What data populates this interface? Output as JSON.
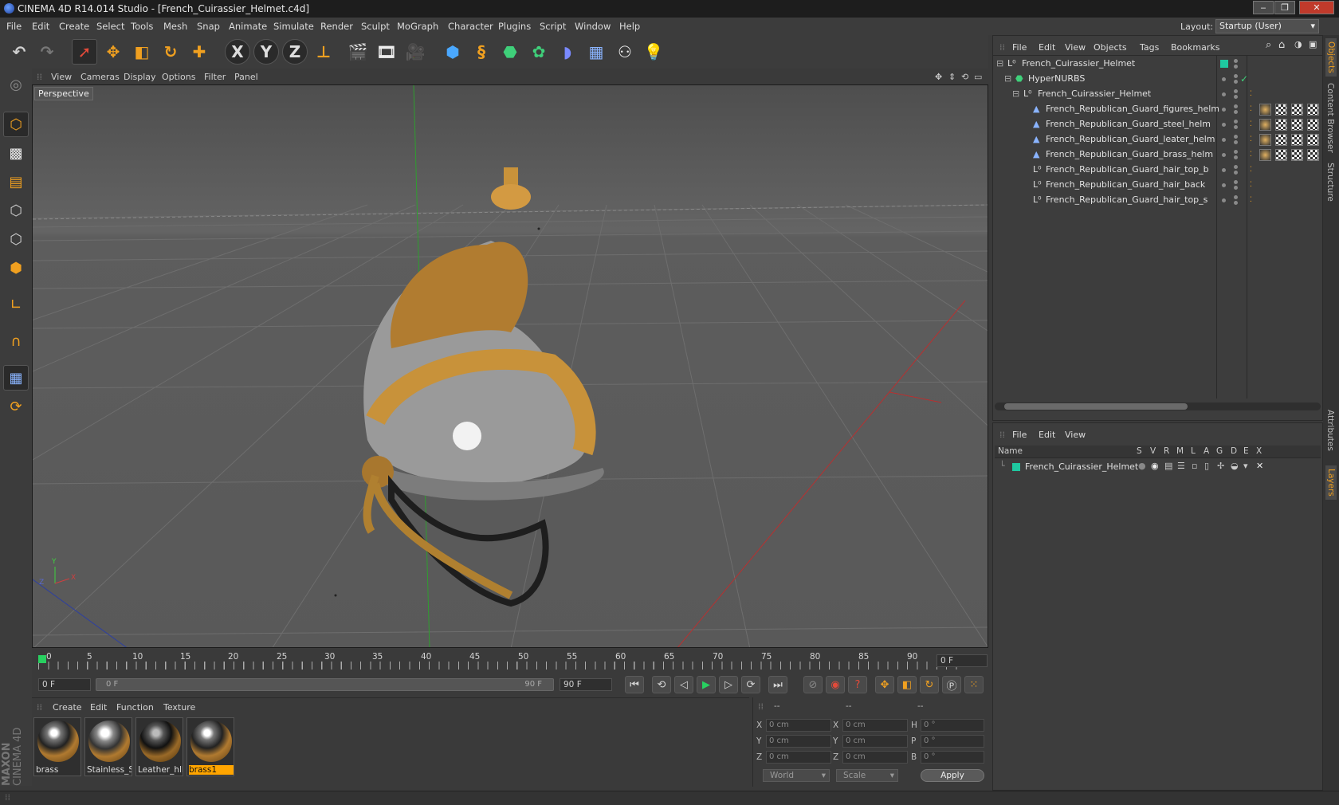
{
  "window": {
    "title": "CINEMA 4D R14.014 Studio - [French_Cuirassier_Helmet.c4d]",
    "controls": [
      "‒",
      "❐",
      "✕"
    ]
  },
  "menu": [
    "File",
    "Edit",
    "Create",
    "Select",
    "Tools",
    "Mesh",
    "Snap",
    "Animate",
    "Simulate",
    "Render",
    "Sculpt",
    "MoGraph",
    "Character",
    "Plugins",
    "Script",
    "Window",
    "Help"
  ],
  "layout": {
    "label": "Layout:",
    "value": "Startup (User)"
  },
  "axis_buttons": [
    "X",
    "Y",
    "Z"
  ],
  "viewport": {
    "menu": [
      "View",
      "Cameras",
      "Display",
      "Options",
      "Filter",
      "Panel"
    ],
    "label": "Perspective"
  },
  "timeline": {
    "ticks": [
      "0",
      "5",
      "10",
      "15",
      "20",
      "25",
      "30",
      "35",
      "40",
      "45",
      "50",
      "55",
      "60",
      "65",
      "70",
      "75",
      "80",
      "85",
      "90"
    ],
    "current_frame": "0 F",
    "start_field": "0 F",
    "range_start": "0 F",
    "range_end": "90 F",
    "end_field": "90 F"
  },
  "materials": {
    "menu": [
      "Create",
      "Edit",
      "Function",
      "Texture"
    ],
    "items": [
      {
        "name": "brass",
        "selected": false
      },
      {
        "name": "Stainless_S",
        "selected": false
      },
      {
        "name": "Leather_hll",
        "selected": false
      },
      {
        "name": "brass1",
        "selected": true
      }
    ]
  },
  "coordinates": {
    "headers": [
      "--",
      "--",
      "--"
    ],
    "rows": [
      {
        "a": "X",
        "av": "0 cm",
        "b": "X",
        "bv": "0 cm",
        "c": "H",
        "cv": "0 °"
      },
      {
        "a": "Y",
        "av": "0 cm",
        "b": "Y",
        "bv": "0 cm",
        "c": "P",
        "cv": "0 °"
      },
      {
        "a": "Z",
        "av": "0 cm",
        "b": "Z",
        "bv": "0 cm",
        "c": "B",
        "cv": "0 °"
      }
    ],
    "mode": "World",
    "type": "Scale",
    "apply": "Apply"
  },
  "objects": {
    "menu": [
      "File",
      "Edit",
      "View",
      "Objects",
      "Tags",
      "Bookmarks"
    ],
    "tree": [
      {
        "name": "French_Cuirassier_Helmet",
        "icon": "null-icon",
        "tags": 0
      },
      {
        "name": "HyperNURBS",
        "icon": "hypernurbs-icon",
        "tags": 0
      },
      {
        "name": "French_Cuirassier_Helmet",
        "icon": "null-icon",
        "tags": 0
      },
      {
        "name": "French_Republican_Guard_figures_helm",
        "icon": "polygon-icon",
        "tags": 3
      },
      {
        "name": "French_Republican_Guard_steel_helm",
        "icon": "polygon-icon",
        "tags": 3
      },
      {
        "name": "French_Republican_Guard_leater_helm",
        "icon": "polygon-icon",
        "tags": 3
      },
      {
        "name": "French_Republican_Guard_brass_helm",
        "icon": "polygon-icon",
        "tags": 3
      },
      {
        "name": "French_Republican_Guard_hair_top_b",
        "icon": "null-icon",
        "tags": 0
      },
      {
        "name": "French_Republican_Guard_hair_back",
        "icon": "null-icon",
        "tags": 0
      },
      {
        "name": "French_Republican_Guard_hair_top_s",
        "icon": "null-icon",
        "tags": 0
      }
    ]
  },
  "layers": {
    "menu": [
      "File",
      "Edit",
      "View"
    ],
    "headers": [
      "Name",
      "S",
      "V",
      "R",
      "M",
      "L",
      "A",
      "G",
      "D",
      "E",
      "X"
    ],
    "row": "French_Cuirassier_Helmet"
  },
  "right_tabs": [
    "Objects",
    "Content Browser",
    "Structure",
    "Attributes",
    "Layers"
  ],
  "brand": {
    "line1": "MAXON",
    "line2": "CINEMA 4D"
  },
  "colors": {
    "accent": "#f0a020",
    "teal": "#1fc8a0",
    "selected": "#ffa500"
  }
}
